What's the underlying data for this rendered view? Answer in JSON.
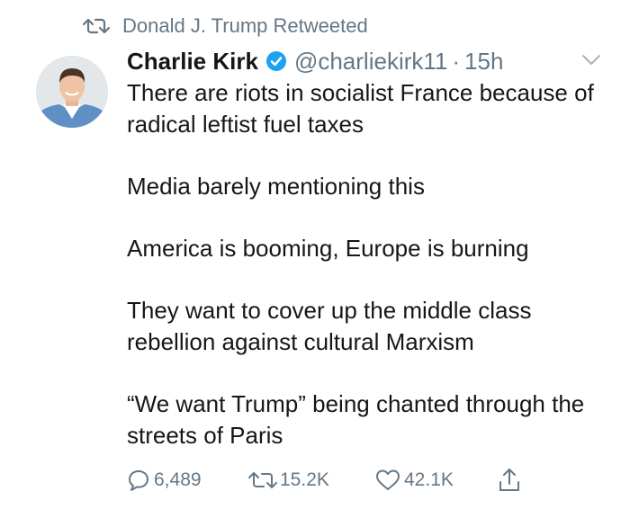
{
  "retweet_banner": {
    "text": "Donald J. Trump Retweeted",
    "icon": "retweet-icon"
  },
  "tweet": {
    "author": {
      "display_name": "Charlie Kirk",
      "verified": true,
      "handle": "@charliekirk11",
      "separator": "·",
      "time": "15h"
    },
    "paragraphs": [
      "There are riots in socialist France because of radical leftist fuel taxes",
      "Media barely mentioning this",
      "America is booming, Europe is burning",
      "They want to cover up the middle class rebellion against cultural Marxism",
      "“We want Trump” being chanted through the streets of Paris"
    ],
    "actions": {
      "replies": "6,489",
      "retweets": "15.2K",
      "likes": "42.1K"
    }
  },
  "colors": {
    "text": "#14171a",
    "muted": "#657786",
    "verified": "#1da1f2"
  }
}
